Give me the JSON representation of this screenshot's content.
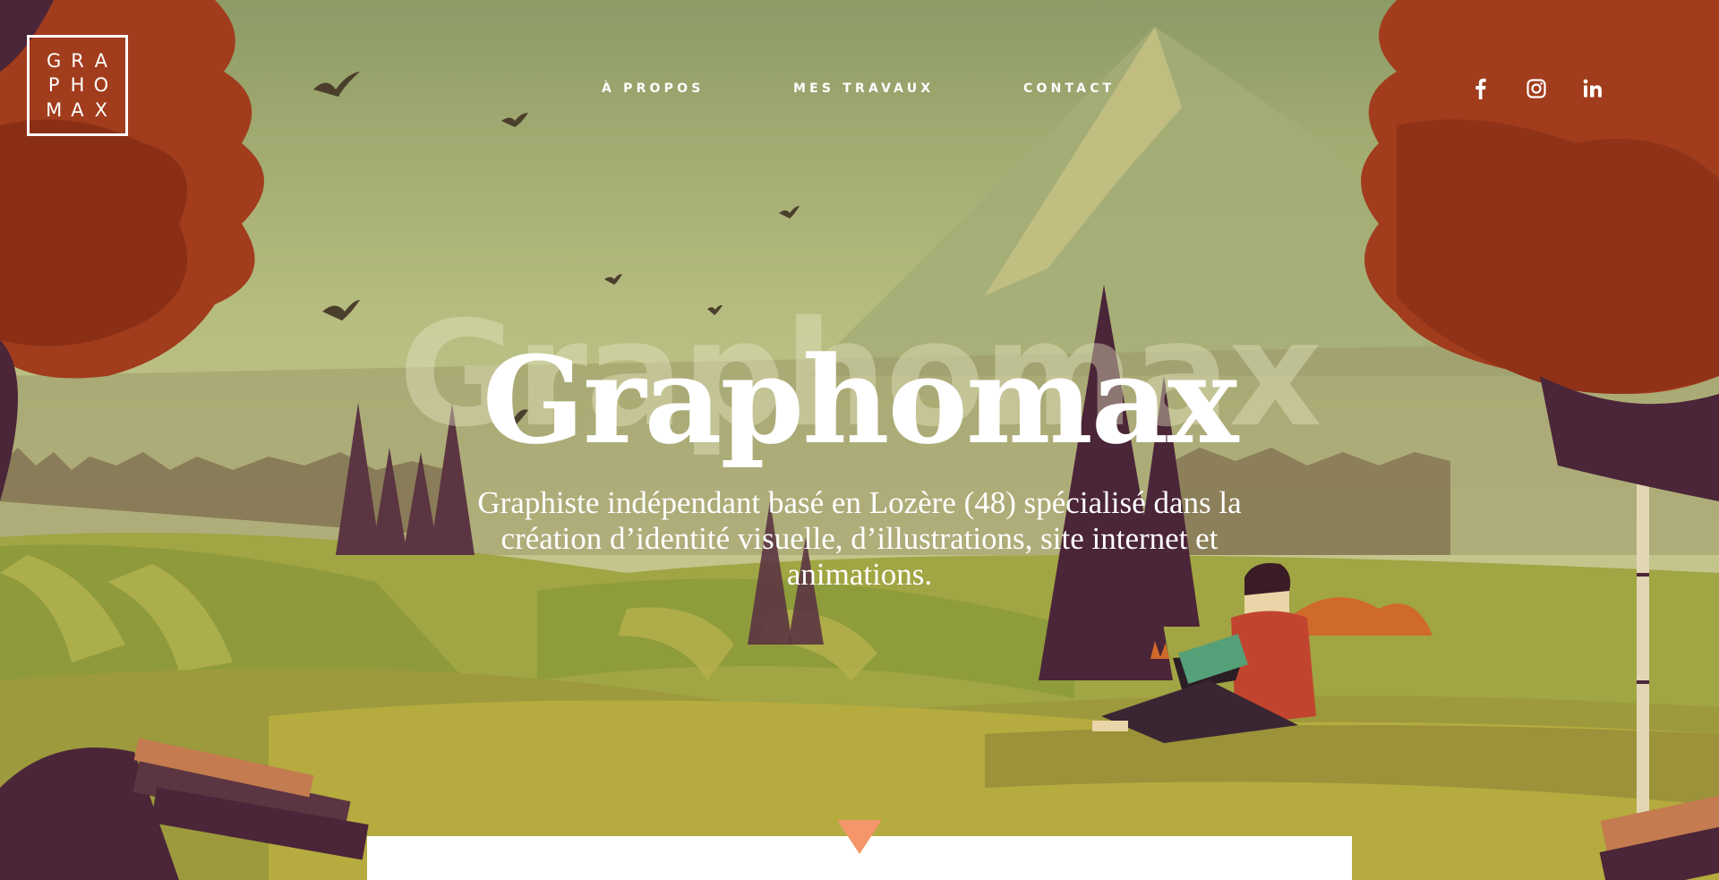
{
  "logo": {
    "letters": [
      "G",
      "R",
      "A",
      "P",
      "H",
      "O",
      "M",
      "A",
      "X"
    ]
  },
  "nav": {
    "items": [
      {
        "label": "À PROPOS"
      },
      {
        "label": "MES TRAVAUX"
      },
      {
        "label": "CONTACT"
      }
    ]
  },
  "social": {
    "icons": [
      "facebook-icon",
      "instagram-icon",
      "linkedin-icon"
    ]
  },
  "hero": {
    "watermark": "Graphomax",
    "title": "Graphomax",
    "subtitle": "Graphiste indépendant basé en Lozère (48) spécialisé dans la création d’identité visuelle, d’illustrations, site internet et animations."
  },
  "colors": {
    "accent": "#f4956a",
    "sky": "#b9bf7e",
    "tree": "#a13c1c",
    "purple": "#4b2538"
  }
}
